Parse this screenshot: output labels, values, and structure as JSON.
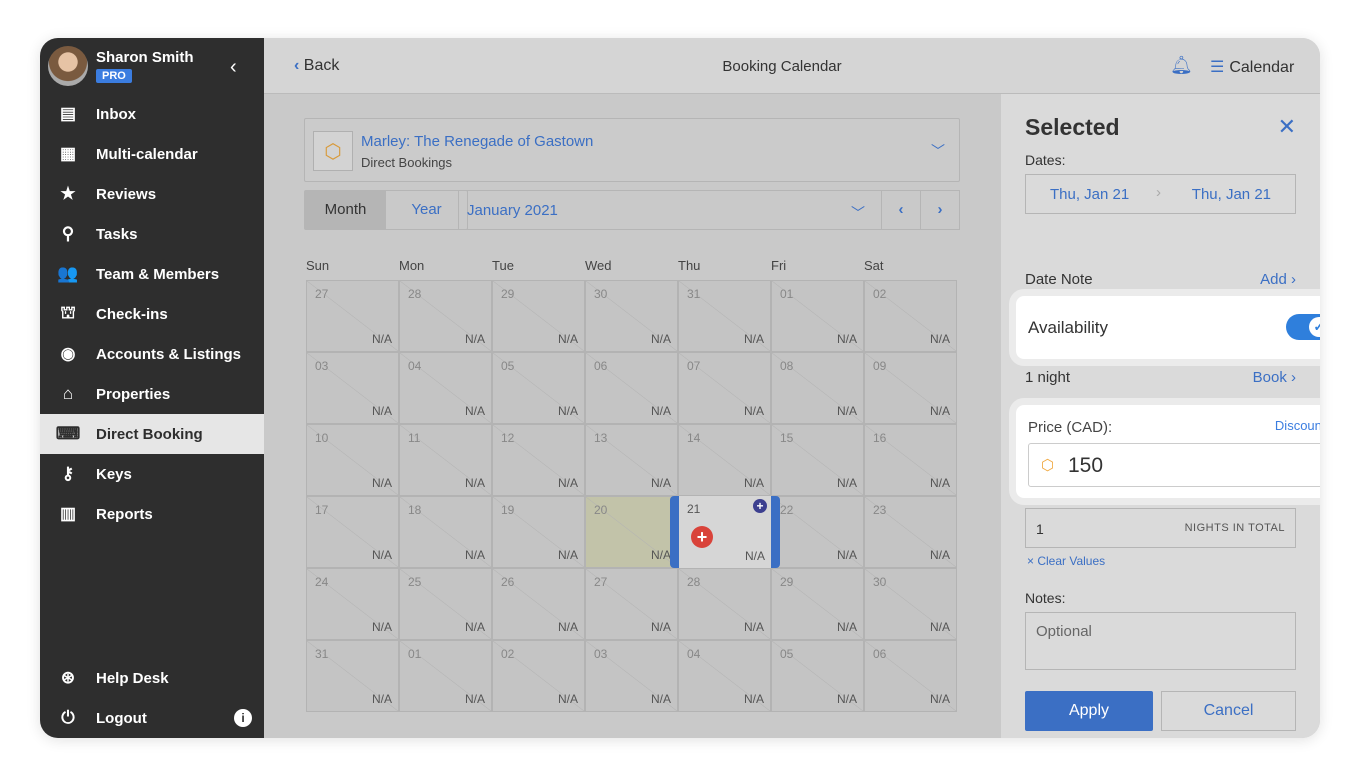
{
  "user": {
    "name": "Sharon Smith",
    "badge": "PRO"
  },
  "sidebar": {
    "items": [
      {
        "label": "Inbox",
        "icon": "inbox-icon",
        "glyph": "▤"
      },
      {
        "label": "Multi-calendar",
        "icon": "calendar-icon",
        "glyph": "▦"
      },
      {
        "label": "Reviews",
        "icon": "star-icon",
        "glyph": "★"
      },
      {
        "label": "Tasks",
        "icon": "broom-icon",
        "glyph": "⚲"
      },
      {
        "label": "Team & Members",
        "icon": "team-icon",
        "glyph": "👥"
      },
      {
        "label": "Check-ins",
        "icon": "bell-desk-icon",
        "glyph": "⛫"
      },
      {
        "label": "Accounts & Listings",
        "icon": "account-icon",
        "glyph": "◉"
      },
      {
        "label": "Properties",
        "icon": "home-icon",
        "glyph": "⌂"
      },
      {
        "label": "Direct Booking",
        "icon": "code-window-icon",
        "glyph": "⌨",
        "active": true
      },
      {
        "label": "Keys",
        "icon": "key-icon",
        "glyph": "⚷"
      },
      {
        "label": "Reports",
        "icon": "chart-icon",
        "glyph": "▥"
      }
    ],
    "help": "Help Desk",
    "logout": "Logout"
  },
  "header": {
    "back": "Back",
    "title": "Booking Calendar",
    "calendar": "Calendar"
  },
  "listing": {
    "name": "Marley: The Renegade of Gastown",
    "channel": "Direct Bookings"
  },
  "view": {
    "month": "Month",
    "year": "Year",
    "current": "January 2021"
  },
  "weekdays": [
    "Sun",
    "Mon",
    "Tue",
    "Wed",
    "Thu",
    "Fri",
    "Sat"
  ],
  "days": [
    "27",
    "28",
    "29",
    "30",
    "31",
    "01",
    "02",
    "03",
    "04",
    "05",
    "06",
    "07",
    "08",
    "09",
    "10",
    "11",
    "12",
    "13",
    "14",
    "15",
    "16",
    "17",
    "18",
    "19",
    "20",
    "21",
    "22",
    "23",
    "24",
    "25",
    "26",
    "27",
    "28",
    "29",
    "30",
    "31",
    "01",
    "02",
    "03",
    "04",
    "05",
    "06"
  ],
  "cell_value": "N/A",
  "panel": {
    "title": "Selected",
    "dates_label": "Dates:",
    "date_from": "Thu, Jan 21",
    "date_to": "Thu, Jan 21",
    "date_note": "Date Note",
    "add": "Add",
    "availability": "Availability",
    "availability_on": true,
    "nights": "1 night",
    "book": "Book",
    "price_label": "Price (CAD):",
    "discounts": "Discounts",
    "price": "150",
    "min_stay": "1",
    "nights_total": "NIGHTS IN TOTAL",
    "clear": "Clear Values",
    "notes_label": "Notes:",
    "notes_placeholder": "Optional",
    "apply": "Apply",
    "cancel": "Cancel"
  },
  "colors": {
    "accent": "#3b6fc4",
    "sidebar": "#2e2e2e",
    "toggle": "#2f7fdc"
  }
}
